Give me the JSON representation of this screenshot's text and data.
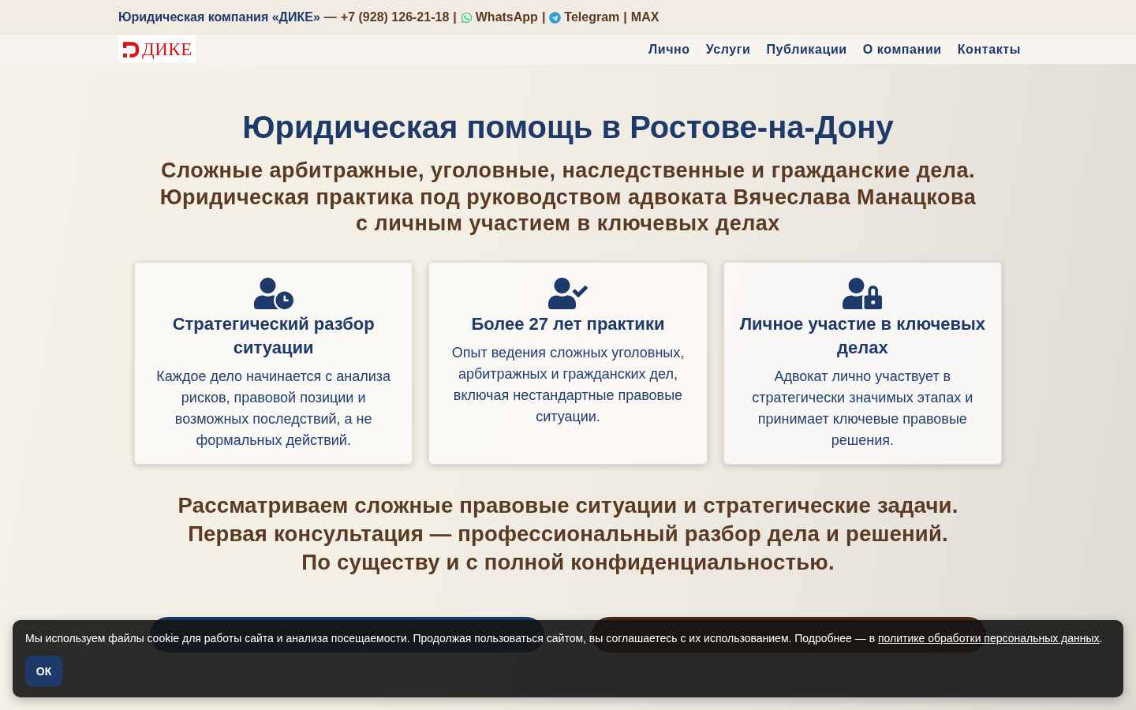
{
  "top_bar": {
    "company": "Юридическая компания «ДИКЕ»",
    "dash": "—",
    "links": [
      {
        "kind": "phone",
        "label": "+7 (928) 126-21-18"
      },
      {
        "kind": "whatsapp",
        "prefix": "|",
        "label": "WhatsApp"
      },
      {
        "kind": "telegram",
        "prefix": "|",
        "label": "Telegram"
      },
      {
        "kind": "max",
        "prefix": "|",
        "label": "MAX"
      }
    ]
  },
  "nav": {
    "logo": "ДИКЕ",
    "items": [
      "Лично",
      "Услуги",
      "Публикации",
      "О компании",
      "Контакты"
    ]
  },
  "hero": {
    "title": "Юридическая помощь в Ростове-на-Дону",
    "subtitle_lines": [
      "Сложные арбитражные, уголовные, наследственные и гражданские дела.",
      "Юридическая практика под руководством адвоката Вячеслава Манацкова",
      "с личным участием в ключевых делах"
    ],
    "cards": [
      {
        "kind": "analysis",
        "title": "Стратегический разбор ситуации",
        "text": "Каждое дело начинается с анализа рисков, правовой позиции и возможных последствий, а не формальных действий."
      },
      {
        "kind": "experience",
        "title": "Более 27 лет практики",
        "text": "Опыт ведения сложных уголовных, арбитражных и гражданских дел, включая нестандартные правовые ситуации."
      },
      {
        "kind": "participation",
        "title": "Личное участие в ключевых делах",
        "text": "Адвокат лично участвует в стратегически значимых этапах и принимает ключевые правовые решения."
      }
    ],
    "tagline_lines": [
      "Рассматриваем сложные правовые ситуации и стратегические задачи.",
      "Первая консультация — профессиональный разбор дела и решений.",
      "По существу и с полной конфиденциальностью."
    ],
    "buttons": [
      {
        "kind": "primary"
      },
      {
        "kind": "secondary"
      }
    ]
  },
  "cookie_banner": {
    "text": "Мы используем файлы cookie для работы сайта и анализа посещаемости. Продолжая пользоваться сайтом, вы соглашаетесь с их использованием. Подробнее — в ",
    "link": "политике обработки персональных данных",
    "after": ".",
    "button": "ОК"
  }
}
